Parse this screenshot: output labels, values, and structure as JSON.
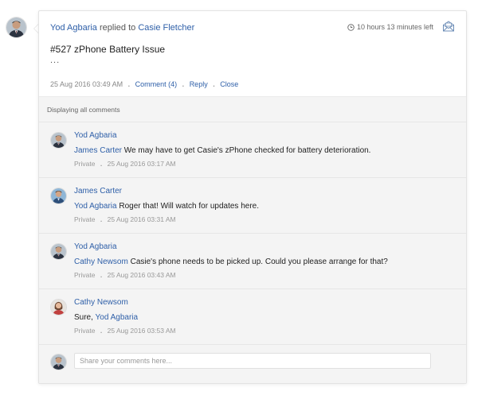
{
  "ticket": {
    "author": "Yod Agbaria",
    "action": "replied to",
    "recipient": "Casie Fletcher",
    "timer": "10 hours 13 minutes left",
    "title": "#527 zPhone Battery Issue",
    "body": "...",
    "timestamp": "25 Aug 2016 03:49 AM",
    "comment_link": "Comment (4)",
    "reply_link": "Reply",
    "close_link": "Close"
  },
  "comments_header": "Displaying all comments",
  "comments": [
    {
      "author": "Yod Agbaria",
      "mention": "James Carter",
      "text": "We may have to get Casie's zPhone checked for battery deterioration.",
      "visibility": "Private",
      "time": "25 Aug 2016 03:17 AM"
    },
    {
      "author": "James Carter",
      "mention": "Yod Agbaria",
      "text": "Roger that! Will watch for updates here.",
      "visibility": "Private",
      "time": "25 Aug 2016 03:31 AM"
    },
    {
      "author": "Yod Agbaria",
      "mention": "Cathy Newsom",
      "text": "Casie's phone needs to be picked up. Could you please arrange for that?",
      "visibility": "Private",
      "time": "25 Aug 2016 03:43 AM"
    },
    {
      "author": "Cathy Newsom",
      "text": "Sure,",
      "mention": "Yod Agbaria",
      "visibility": "Private",
      "time": "25 Aug 2016 03:53 AM"
    }
  ],
  "reply": {
    "placeholder": "Share your comments here..."
  },
  "colors": {
    "link": "#2e5fa8",
    "panel_bg": "#f4f4f4",
    "card_border": "#e3e3e3"
  },
  "icons": {
    "timer": "clock-icon",
    "envelope": "mail-icon"
  }
}
